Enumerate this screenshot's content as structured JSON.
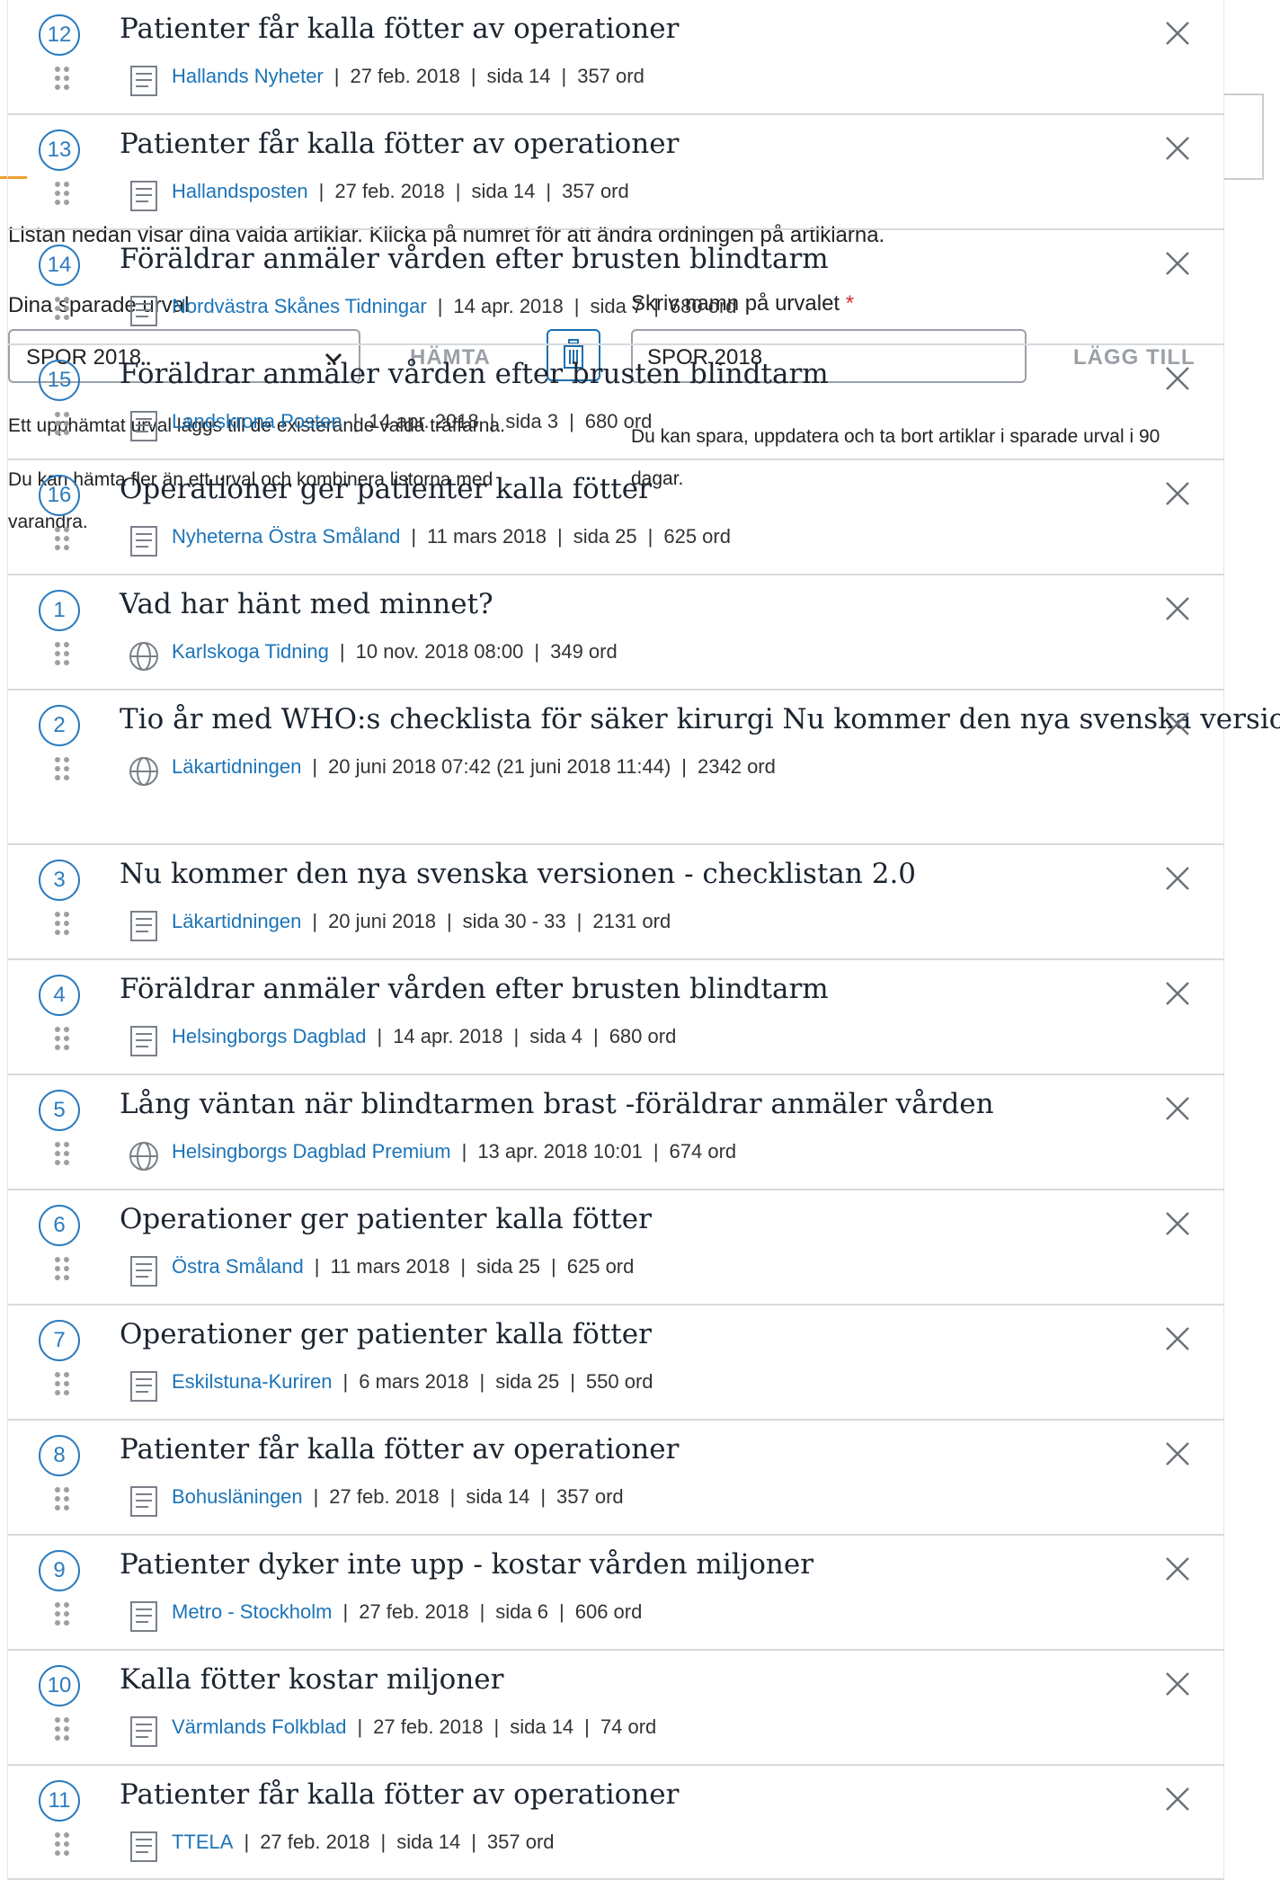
{
  "panel": {
    "intro": "Listan nedan visar dina valda artiklar. Klicka på numret för att ändra ordningen på artiklarna.",
    "saved_label": "Dina sparade urval",
    "saved_select_value": "SPOR 2018",
    "fetch_label": "HÄMTA",
    "name_label": "Skriv namn på urvalet",
    "required_mark": "*",
    "name_value": "SPOR 2018",
    "add_label": "LÄGG TILL",
    "help_fetch": "Ett upphämtat urval läggs till de existerande valda träffarna.",
    "help_combine": "Du kan hämta fler än ett urval och kombinera listorna med varandra.",
    "help_save": "Du kan spara, uppdatera och ta bort artiklar i sparade urval i 90 dagar."
  },
  "articles": [
    {
      "num": "12",
      "title": "Patienter får kalla fötter av operationer",
      "source": "Hallands Nyheter",
      "date": "27 feb. 2018",
      "page": "sida 14",
      "words": "357 ord",
      "icon": "newspaper-icon"
    },
    {
      "num": "13",
      "title": "Patienter får kalla fötter av operationer",
      "source": "Hallandsposten",
      "date": "27 feb. 2018",
      "page": "sida 14",
      "words": "357 ord",
      "icon": "newspaper-icon"
    },
    {
      "num": "14",
      "title": "Föräldrar anmäler vården efter brusten blindtarm",
      "source": "Nordvästra Skånes Tidningar",
      "date": "14 apr. 2018",
      "page": "sida 7",
      "words": "680 ord",
      "icon": "newspaper-icon"
    },
    {
      "num": "15",
      "title": "Föräldrar anmäler vården efter brusten blindtarm",
      "source": "Landskrona Posten",
      "date": "14 apr. 2018",
      "page": "sida 3",
      "words": "680 ord",
      "icon": "newspaper-icon"
    },
    {
      "num": "16",
      "title": "Operationer ger patienter kalla fötter",
      "source": "Nyheterna Östra Småland",
      "date": "11 mars 2018",
      "page": "sida 25",
      "words": "625 ord",
      "icon": "newspaper-icon"
    },
    {
      "num": "1",
      "title": "Vad har hänt med minnet?",
      "source": "Karlskoga Tidning",
      "date": "10 nov. 2018 08:00",
      "page": "",
      "words": "349 ord",
      "icon": "globe-icon"
    },
    {
      "num": "2",
      "title": "Tio år med WHO:s checklista för säker kirurgi Nu kommer den nya svenska versionen",
      "source": "Läkartidningen",
      "date": "20 juni 2018 07:42  (21 juni 2018 11:44)",
      "page": "",
      "words": "2342 ord",
      "icon": "globe-icon"
    },
    {
      "num": "3",
      "title": "Nu kommer den nya svenska versionen - checklistan 2.0",
      "source": "Läkartidningen",
      "date": "20 juni 2018",
      "page": "sida 30 - 33",
      "words": "2131 ord",
      "icon": "newspaper-icon"
    },
    {
      "num": "4",
      "title": "Föräldrar anmäler vården efter brusten blindtarm",
      "source": "Helsingborgs Dagblad",
      "date": "14 apr. 2018",
      "page": "sida 4",
      "words": "680 ord",
      "icon": "newspaper-icon"
    },
    {
      "num": "5",
      "title": "Lång väntan när blindtarmen brast -föräldrar anmäler vården",
      "source": "Helsingborgs Dagblad Premium",
      "date": "13 apr. 2018 10:01",
      "page": "",
      "words": "674 ord",
      "icon": "globe-icon"
    },
    {
      "num": "6",
      "title": "Operationer ger patienter kalla fötter",
      "source": "Östra Småland",
      "date": "11 mars 2018",
      "page": "sida 25",
      "words": "625 ord",
      "icon": "newspaper-icon"
    },
    {
      "num": "7",
      "title": "Operationer ger patienter kalla fötter",
      "source": "Eskilstuna-Kuriren",
      "date": "6 mars 2018",
      "page": "sida 25",
      "words": "550 ord",
      "icon": "newspaper-icon"
    },
    {
      "num": "8",
      "title": "Patienter får kalla fötter av operationer",
      "source": "Bohusläningen",
      "date": "27 feb. 2018",
      "page": "sida 14",
      "words": "357 ord",
      "icon": "newspaper-icon"
    },
    {
      "num": "9",
      "title": "Patienter dyker inte upp - kostar vården miljoner",
      "source": "Metro - Stockholm",
      "date": "27 feb. 2018",
      "page": "sida 6",
      "words": "606 ord",
      "icon": "newspaper-icon"
    },
    {
      "num": "10",
      "title": "Kalla fötter kostar miljoner",
      "source": "Värmlands Folkblad",
      "date": "27 feb. 2018",
      "page": "sida 14",
      "words": "74 ord",
      "icon": "newspaper-icon"
    },
    {
      "num": "11",
      "title": "Patienter får kalla fötter av operationer",
      "source": "TTELA",
      "date": "27 feb. 2018",
      "page": "sida 14",
      "words": "357 ord",
      "icon": "newspaper-icon"
    }
  ]
}
